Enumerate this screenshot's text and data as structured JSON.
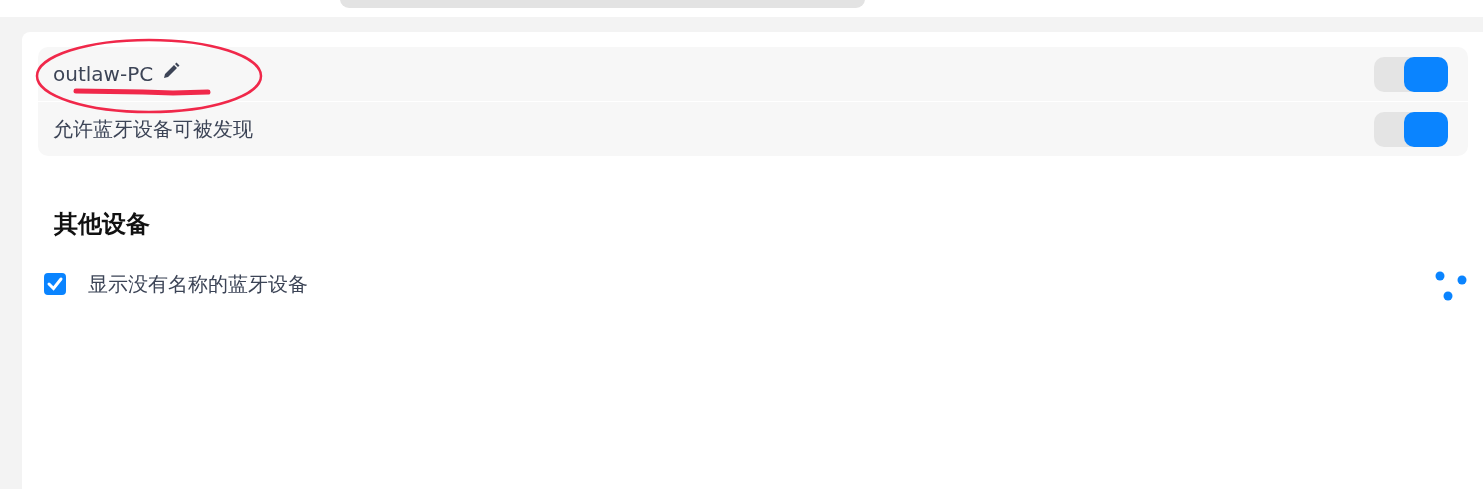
{
  "device_settings": [
    {
      "kind": "name",
      "label": "outlaw-PC",
      "on": true
    },
    {
      "kind": "plain",
      "label": "允许蓝牙设备可被发现",
      "on": true
    }
  ],
  "markup": {
    "ellipse": {
      "color": "#f0284a"
    },
    "scribble": {
      "color": "#f0284a"
    }
  },
  "other_devices": {
    "title": "其他设备",
    "show_unnamed": {
      "label": "显示没有名称的蓝牙设备",
      "checked": true
    },
    "loading": true
  }
}
